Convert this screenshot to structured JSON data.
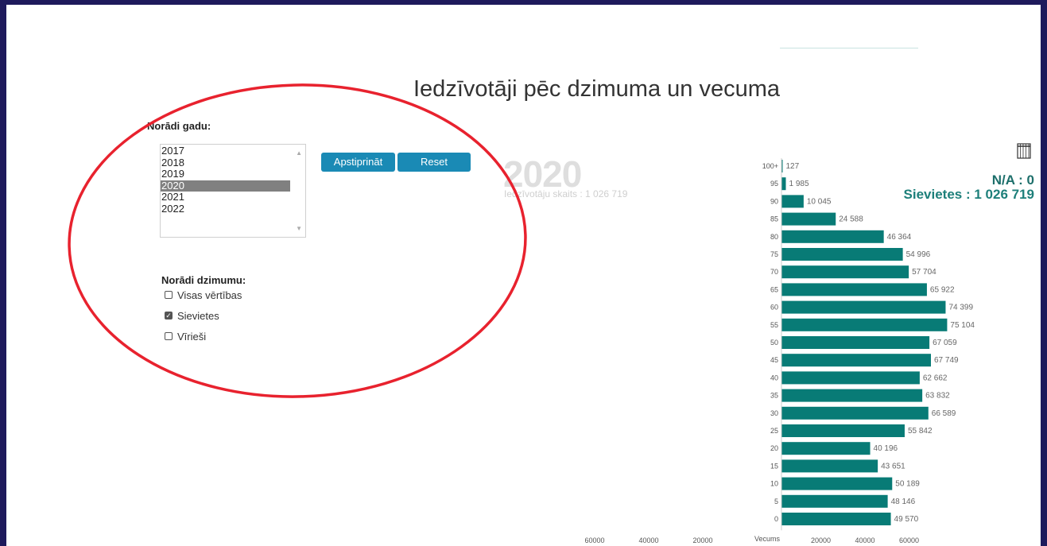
{
  "title": "Iedzīvotāji pēc dzimuma un vecuma",
  "year_section": {
    "label": "Norādi gadu:",
    "options": [
      "2017",
      "2018",
      "2019",
      "2020",
      "2021",
      "2022"
    ],
    "selected": "2020"
  },
  "buttons": {
    "confirm": "Apstiprināt",
    "reset": "Reset"
  },
  "gender_section": {
    "label": "Norādi dzimumu:",
    "options": [
      {
        "label": "Visas vērtības",
        "checked": false
      },
      {
        "label": "Sievietes",
        "checked": true
      },
      {
        "label": "Vīrieši",
        "checked": false
      }
    ]
  },
  "big_year": "2020",
  "population_total_text": "Iedzīvotāju skaits : 1 026 719",
  "na_text": "N/A : 0",
  "women_total_text": "Sievietes : 1 026 719",
  "colors": {
    "bar": "#087b76",
    "annotation": "#e8222e",
    "button": "#1a8ab5",
    "frame": "#1e1a5c"
  },
  "icons": {
    "table_toggle": "table-grid-icon"
  },
  "chart_data": {
    "type": "bar",
    "orientation": "horizontal",
    "series": [
      {
        "name": "Sievietes",
        "categories": [
          "100+",
          "95",
          "90",
          "85",
          "80",
          "75",
          "70",
          "65",
          "60",
          "55",
          "50",
          "45",
          "40",
          "35",
          "30",
          "25",
          "20",
          "15",
          "10",
          "5",
          "0"
        ],
        "values": [
          127,
          1985,
          10045,
          24588,
          46364,
          54996,
          57704,
          65922,
          74399,
          75104,
          67059,
          67749,
          62662,
          63832,
          66589,
          55842,
          40196,
          43651,
          50189,
          48146,
          49570
        ],
        "labels": [
          "127",
          "1 985",
          "10 045",
          "24 588",
          "46 364",
          "54 996",
          "57 704",
          "65 922",
          "74 399",
          "75 104",
          "67 059",
          "67 749",
          "62 662",
          "63 832",
          "66 589",
          "55 842",
          "40 196",
          "43 651",
          "50 189",
          "48 146",
          "49 570"
        ]
      }
    ],
    "xlabel": "Vecums",
    "x_ticks_right": [
      "20000",
      "40000",
      "60000"
    ],
    "x_ticks_left": [
      "60000",
      "40000",
      "20000"
    ]
  }
}
